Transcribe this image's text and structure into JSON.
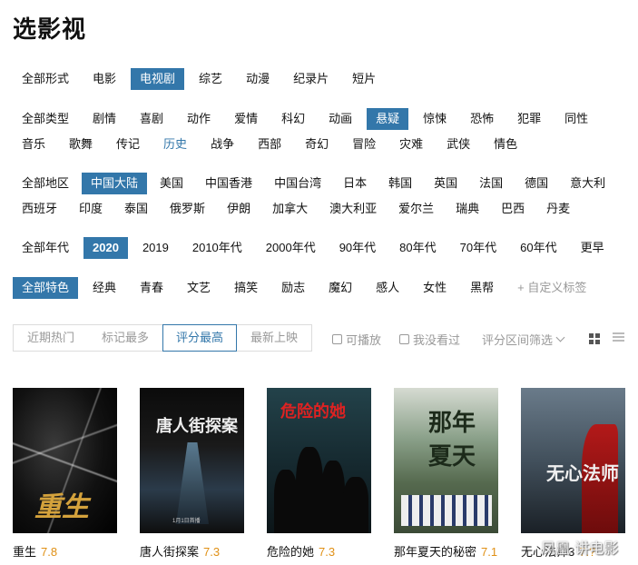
{
  "page_title": "选影视",
  "forms": {
    "items": [
      "全部形式",
      "电影",
      "电视剧",
      "综艺",
      "动漫",
      "纪录片",
      "短片"
    ],
    "selected": 2
  },
  "types": {
    "items": [
      "全部类型",
      "剧情",
      "喜剧",
      "动作",
      "爱情",
      "科幻",
      "动画",
      "悬疑",
      "惊悚",
      "恐怖",
      "犯罪",
      "同性",
      "音乐",
      "歌舞",
      "传记",
      "历史",
      "战争",
      "西部",
      "奇幻",
      "冒险",
      "灾难",
      "武侠",
      "情色"
    ],
    "selected": 7,
    "highlighted": 15
  },
  "regions": {
    "items": [
      "全部地区",
      "中国大陆",
      "美国",
      "中国香港",
      "中国台湾",
      "日本",
      "韩国",
      "英国",
      "法国",
      "德国",
      "意大利",
      "西班牙",
      "印度",
      "泰国",
      "俄罗斯",
      "伊朗",
      "加拿大",
      "澳大利亚",
      "爱尔兰",
      "瑞典",
      "巴西",
      "丹麦"
    ],
    "selected": 1
  },
  "years": {
    "items": [
      "全部年代",
      "2020",
      "2019",
      "2010年代",
      "2000年代",
      "90年代",
      "80年代",
      "70年代",
      "60年代",
      "更早"
    ],
    "selected": 1
  },
  "features": {
    "items": [
      "全部特色",
      "经典",
      "青春",
      "文艺",
      "搞笑",
      "励志",
      "魔幻",
      "感人",
      "女性",
      "黑帮"
    ],
    "custom_label": "+ 自定义标签",
    "selected": 0
  },
  "sort": {
    "tabs": [
      "近期热门",
      "标记最多",
      "评分最高",
      "最新上映"
    ],
    "active": 2
  },
  "filters": {
    "playable": "可播放",
    "not_watched": "我没看过",
    "range": "评分区间筛选"
  },
  "view_icons": [
    "grid-view-icon",
    "list-view-icon"
  ],
  "movies": [
    {
      "title": "重生",
      "rating": "7.8",
      "poster_text": "重生"
    },
    {
      "title": "唐人街探案",
      "rating": "7.3",
      "poster_text": "唐人街探案",
      "poster_date": "1月1日首播"
    },
    {
      "title": "危险的她",
      "rating": "7.3",
      "poster_text": "危险的她"
    },
    {
      "title": "那年夏天的秘密",
      "rating": "7.1",
      "poster_text": "那年夏天"
    },
    {
      "title": "无心法师3",
      "rating": "7.?",
      "poster_text": "无心法师"
    }
  ],
  "watermark": "凤凰·讲电影",
  "colors": {
    "accent": "#3377aa",
    "rating": "#e09015",
    "muted": "#999999"
  }
}
